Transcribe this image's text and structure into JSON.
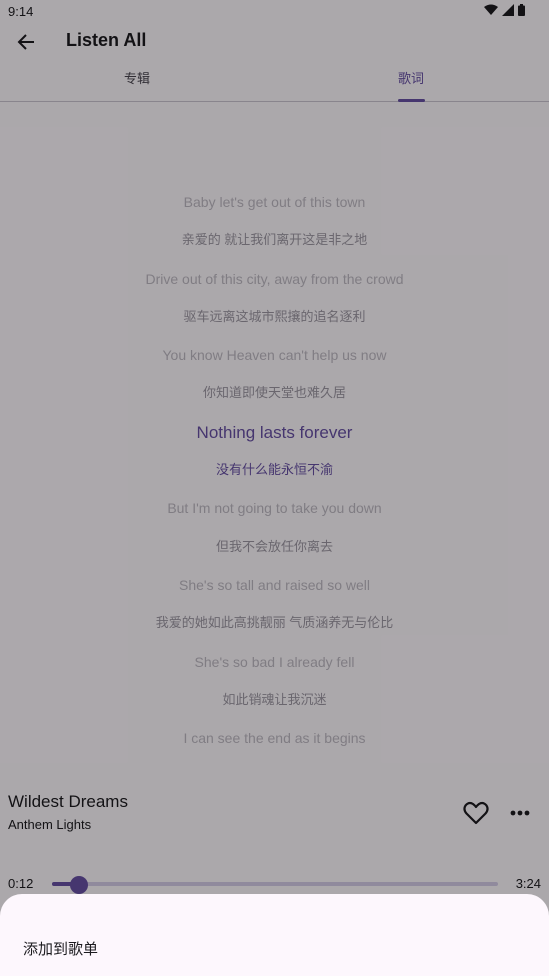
{
  "status_bar": {
    "time": "9:14"
  },
  "app_bar": {
    "title": "Listen All"
  },
  "tabs": [
    {
      "label": "专辑",
      "active": false
    },
    {
      "label": "歌词",
      "active": true
    }
  ],
  "lyrics": [
    {
      "text": "Baby let's get out of this town",
      "type": "en"
    },
    {
      "text": "亲爱的 就让我们离开这是非之地",
      "type": "cn"
    },
    {
      "text": "Drive out of this city, away from the crowd",
      "type": "en"
    },
    {
      "text": "驱车远离这城市熙攘的追名逐利",
      "type": "cn"
    },
    {
      "text": "You know Heaven can't help us now",
      "type": "en"
    },
    {
      "text": "你知道即使天堂也难久居",
      "type": "cn"
    },
    {
      "text": "Nothing lasts forever",
      "type": "active"
    },
    {
      "text": "没有什么能永恒不渝",
      "type": "active-cn"
    },
    {
      "text": "But I'm not going to take you down",
      "type": "en"
    },
    {
      "text": "但我不会放任你离去",
      "type": "cn"
    },
    {
      "text": "She's so tall and raised so well",
      "type": "en"
    },
    {
      "text": "我爱的她如此高挑靓丽 气质涵养无与伦比",
      "type": "cn"
    },
    {
      "text": "She's so bad I already fell",
      "type": "en"
    },
    {
      "text": "如此销魂让我沉迷",
      "type": "cn"
    },
    {
      "text": "I can see the end as it begins",
      "type": "en"
    }
  ],
  "player": {
    "title": "Wildest Dreams",
    "artist": "Anthem Lights",
    "current_time": "0:12",
    "total_time": "3:24",
    "progress": 0.06
  },
  "sheet": {
    "item_label": "添加到歌单"
  },
  "colors": {
    "accent": "#6750a4",
    "scrim": "rgba(0,0,0,0.32)"
  }
}
